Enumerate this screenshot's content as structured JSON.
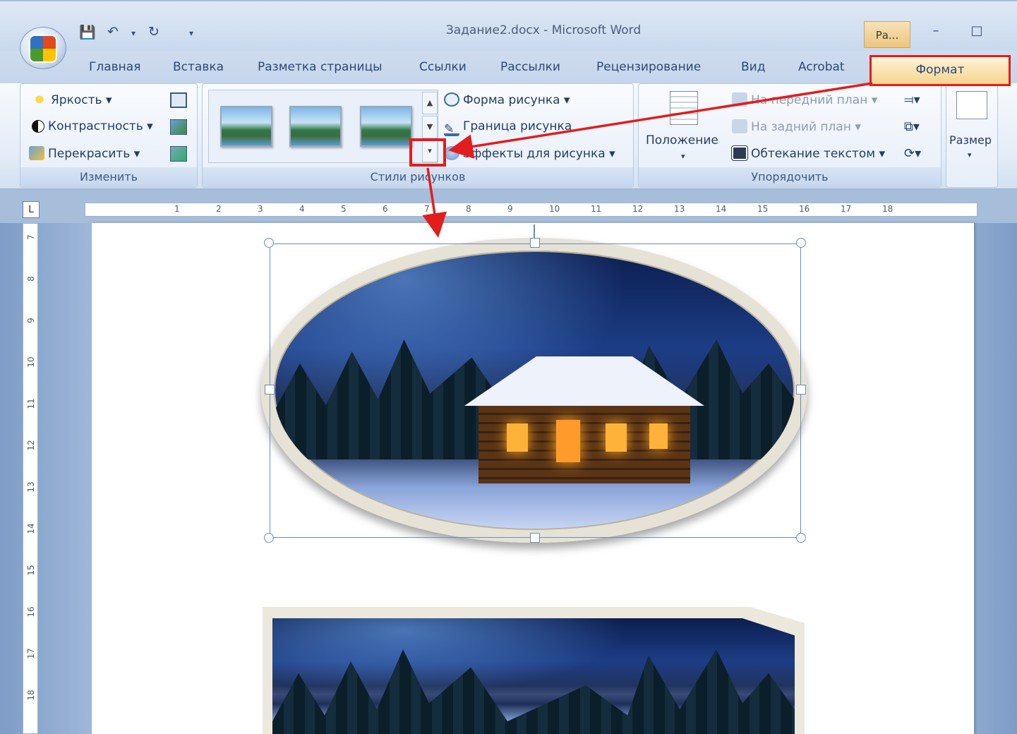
{
  "window": {
    "title": "Задание2.docx - Microsoft Word",
    "context_tab": "Ра...",
    "minimize": "–",
    "maximize": "□"
  },
  "qat": {
    "save_icon": "save-icon",
    "undo_icon": "undo-icon",
    "redo_icon": "redo-icon",
    "customize": "▾"
  },
  "tabs": [
    "Главная",
    "Вставка",
    "Разметка страницы",
    "Ссылки",
    "Рассылки",
    "Рецензирование",
    "Вид",
    "Acrobat"
  ],
  "active_tab": "Формат",
  "groups": {
    "change": {
      "label": "Изменить",
      "brightness": "Яркость",
      "contrast": "Контрастность",
      "recolor": "Перекрасить"
    },
    "styles": {
      "label": "Стили рисунков",
      "shape": "Форма рисунка",
      "border": "Граница рисунка",
      "effects": "Эффекты для рисунка",
      "more_glyph": "▾",
      "scroll_up": "▲",
      "scroll_down": "▼"
    },
    "arrange": {
      "label": "Упорядочить",
      "position": "Положение",
      "bring_front": "На передний план",
      "send_back": "На задний план",
      "text_wrap": "Обтекание текстом"
    },
    "size": {
      "label": "Размер"
    }
  },
  "ruler": {
    "corner": "L",
    "h_marks": [
      "1",
      "2",
      "3",
      "4",
      "5",
      "6",
      "7",
      "8",
      "9",
      "10",
      "11",
      "12",
      "13",
      "14",
      "15",
      "16",
      "17",
      "18"
    ],
    "v_marks": [
      "7",
      "8",
      "9",
      "10",
      "11",
      "12",
      "13",
      "14",
      "15",
      "16",
      "17",
      "18"
    ]
  },
  "colors": {
    "highlight": "#e21d1d",
    "ribbon_text": "#243d66"
  }
}
